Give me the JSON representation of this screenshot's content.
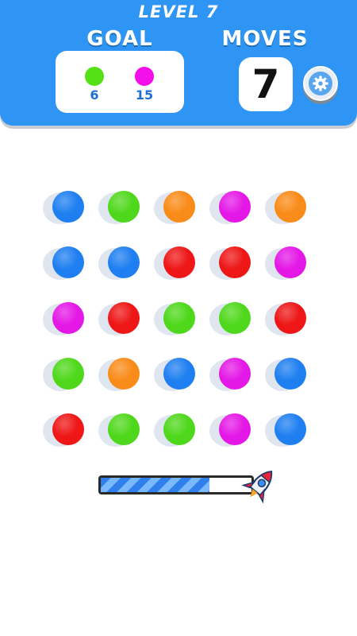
{
  "header": {
    "level_label": "LEVEL 7",
    "goal_label": "GOAL",
    "moves_label": "MOVES",
    "moves_value": "7"
  },
  "goals": [
    {
      "color": "#55e016",
      "count": "6"
    },
    {
      "color": "#f20fe9",
      "count": "15"
    }
  ],
  "colors": {
    "blue": "#1f7ff0",
    "green": "#4fd81b",
    "orange": "#f98b18",
    "magenta": "#e418e6",
    "red": "#ee1616",
    "header": "#2f95f4"
  },
  "board": [
    [
      "blue",
      "green",
      "orange",
      "magenta",
      "orange"
    ],
    [
      "blue",
      "blue",
      "red",
      "red",
      "magenta"
    ],
    [
      "magenta",
      "red",
      "green",
      "green",
      "red"
    ],
    [
      "green",
      "orange",
      "blue",
      "magenta",
      "blue"
    ],
    [
      "red",
      "green",
      "green",
      "magenta",
      "blue"
    ]
  ],
  "progress": {
    "fraction": 0.72
  },
  "icons": {
    "settings": "gear-icon",
    "rocket": "rocket-icon"
  }
}
